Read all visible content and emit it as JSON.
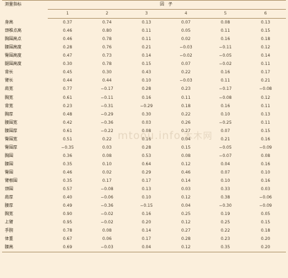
{
  "table": {
    "corner_label": "测量指标",
    "group_label": "因 子",
    "factor_columns": [
      "1",
      "2",
      "3",
      "4",
      "5",
      "6"
    ],
    "rows": [
      {
        "label": "身高",
        "values": [
          "0.37",
          "0.74",
          "0.13",
          "0.07",
          "0.08",
          "0.13"
        ]
      },
      {
        "label": "颈椎点高",
        "values": [
          "0.46",
          "0.80",
          "0.11",
          "0.05",
          "0.11",
          "0.15"
        ]
      },
      {
        "label": "胸围高点",
        "values": [
          "0.46",
          "0.78",
          "0.11",
          "0.02",
          "0.16",
          "0.18"
        ]
      },
      {
        "label": "腰围高度",
        "values": [
          "0.28",
          "0.76",
          "0.21",
          "−0.03",
          "−0.11",
          "0.12"
        ]
      },
      {
        "label": "臀围高度",
        "values": [
          "0.47",
          "0.73",
          "0.14",
          "−0.02",
          "−0.05",
          "0.14"
        ]
      },
      {
        "label": "腿围高度",
        "values": [
          "0.30",
          "0.78",
          "0.15",
          "0.07",
          "−0.02",
          "0.11"
        ]
      },
      {
        "label": "背长",
        "values": [
          "0.45",
          "0.30",
          "0.43",
          "0.22",
          "0.16",
          "0.17"
        ]
      },
      {
        "label": "臂长",
        "values": [
          "0.44",
          "0.44",
          "0.10",
          "−0.03",
          "0.11",
          "0.21"
        ]
      },
      {
        "label": "肩宽",
        "values": [
          "0.77",
          "−0.17",
          "0.28",
          "0.23",
          "−0.17",
          "−0.08"
        ]
      },
      {
        "label": "胸宽",
        "values": [
          "0.61",
          "−0.11",
          "0.16",
          "0.11",
          "−0.08",
          "0.12"
        ]
      },
      {
        "label": "背宽",
        "values": [
          "0.23",
          "−0.31",
          "−0.29",
          "0.18",
          "0.16",
          "0.11"
        ]
      },
      {
        "label": "胸厚",
        "values": [
          "0.48",
          "−0.29",
          "0.30",
          "0.22",
          "0.10",
          "0.13"
        ]
      },
      {
        "label": "腰围宽",
        "values": [
          "0.42",
          "−0.36",
          "0.03",
          "0.26",
          "−0.25",
          "0.11"
        ]
      },
      {
        "label": "腰围厚",
        "values": [
          "0.61",
          "−0.22",
          "0.08",
          "0.27",
          "0.07",
          "0.15"
        ]
      },
      {
        "label": "臀围宽",
        "values": [
          "0.51",
          "0.22",
          "0.16",
          "0.04",
          "0.21",
          "0.16"
        ]
      },
      {
        "label": "臀围厚",
        "values": [
          "−0.35",
          "0.03",
          "0.28",
          "0.15",
          "−0.05",
          "−0.09"
        ]
      },
      {
        "label": "胸围",
        "values": [
          "0.36",
          "0.08",
          "0.53",
          "0.08",
          "−0.07",
          "0.08"
        ]
      },
      {
        "label": "腰围",
        "values": [
          "0.35",
          "0.10",
          "0.64",
          "0.12",
          "0.04",
          "0.16"
        ]
      },
      {
        "label": "臀围",
        "values": [
          "0.46",
          "0.02",
          "0.29",
          "0.46",
          "0.07",
          "0.10"
        ]
      },
      {
        "label": "臂根围",
        "values": [
          "0.35",
          "0.17",
          "0.17",
          "0.14",
          "0.10",
          "0.16"
        ]
      },
      {
        "label": "颈围",
        "values": [
          "0.57",
          "−0.08",
          "0.13",
          "0.03",
          "0.33",
          "0.03"
        ]
      },
      {
        "label": "肩厚",
        "values": [
          "0.40",
          "−0.06",
          "0.10",
          "0.12",
          "0.38",
          "−0.06"
        ]
      },
      {
        "label": "腰厚",
        "values": [
          "0.49",
          "−0.36",
          "−0.15",
          "0.04",
          "−0.30",
          "−0.09"
        ]
      },
      {
        "label": "胸宽",
        "values": [
          "0.90",
          "−0.02",
          "0.16",
          "0.25",
          "0.19",
          "0.05"
        ]
      },
      {
        "label": "上臂",
        "values": [
          "0.95",
          "−0.02",
          "0.20",
          "0.12",
          "0.25",
          "0.15"
        ]
      },
      {
        "label": "手腕",
        "values": [
          "0.78",
          "0.08",
          "0.14",
          "0.27",
          "0.22",
          "0.18"
        ]
      },
      {
        "label": "体重",
        "values": [
          "0.67",
          "0.06",
          "0.17",
          "0.28",
          "0.23",
          "0.20"
        ]
      },
      {
        "label": "腰高",
        "values": [
          "0.69",
          "−0.03",
          "0.04",
          "0.12",
          "0.35",
          "0.20"
        ]
      }
    ]
  },
  "watermark": {
    "latin": "mtoou.info",
    "cn": "木木网"
  },
  "colors": {
    "background": "#fbefdc",
    "rule": "#b59b74",
    "text": "#3a3020"
  }
}
